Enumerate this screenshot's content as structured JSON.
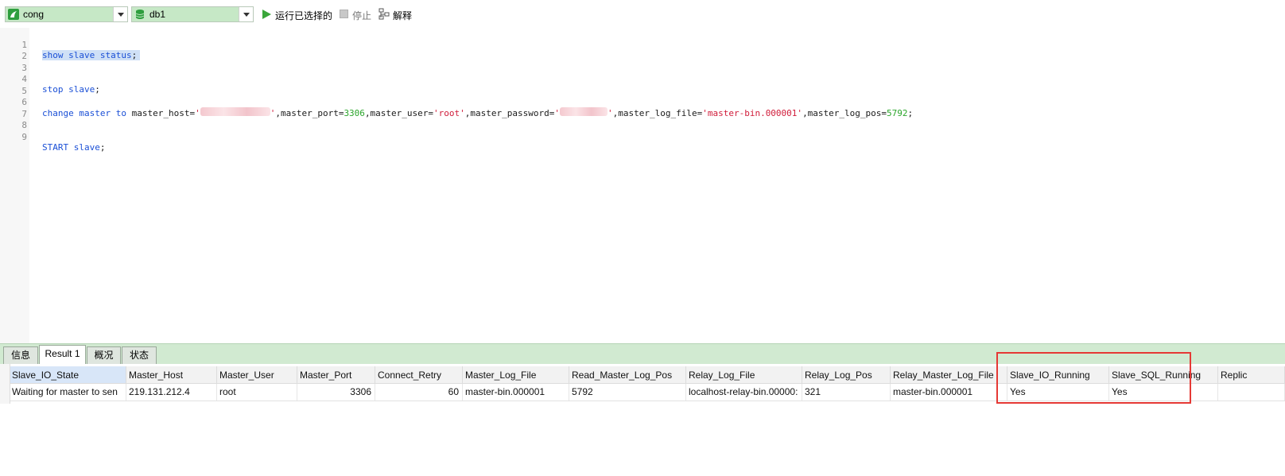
{
  "toolbar": {
    "connection": "cong",
    "database": "db1",
    "run_label": "运行已选择的",
    "stop_label": "停止",
    "explain_label": "解释"
  },
  "editor": {
    "line_numbers": [
      "1",
      "2",
      "3",
      "4",
      "5",
      "6",
      "7",
      "8",
      "9"
    ],
    "line1": {
      "kw1": "show",
      "kw2": "slave",
      "kw3": "status",
      "punct": ";"
    },
    "line4": {
      "kw1": "stop",
      "kw2": "slave",
      "punct": ";"
    },
    "line6": {
      "kw1": "change",
      "kw2": "master",
      "kw3": "to",
      "p1": " master_host=",
      "q1": "'",
      "q1end": "'",
      "p2": ",master_port=",
      "port": "3306",
      "p3": ",master_user=",
      "user": "'root'",
      "p4": ",master_password=",
      "q2": "'",
      "q2end": "'",
      "p5": ",master_log_file=",
      "logfile": "'master-bin.000001'",
      "p6": ",master_log_pos=",
      "pos": "5792",
      "end": ";"
    },
    "line9": {
      "kw1": "START",
      "kw2": "slave",
      "punct": ";"
    }
  },
  "result_tabs": [
    "信息",
    "Result 1",
    "概况",
    "状态"
  ],
  "columns": [
    "Slave_IO_State",
    "Master_Host",
    "Master_User",
    "Master_Port",
    "Connect_Retry",
    "Master_Log_File",
    "Read_Master_Log_Pos",
    "Relay_Log_File",
    "Relay_Log_Pos",
    "Relay_Master_Log_File",
    "Slave_IO_Running",
    "Slave_SQL_Running",
    "Replic"
  ],
  "row": [
    "Waiting for master to sen",
    "219.131.212.4",
    "root",
    "3306",
    "60",
    "master-bin.000001",
    "5792",
    "localhost-relay-bin.00000:",
    "321",
    "master-bin.000001",
    "Yes",
    "Yes",
    ""
  ],
  "colors": {
    "result_bar": "#d1ead1",
    "highlight": "#e53935",
    "keyword": "#1a4fd6",
    "string": "#d01c3a",
    "number": "#2aa52a"
  }
}
